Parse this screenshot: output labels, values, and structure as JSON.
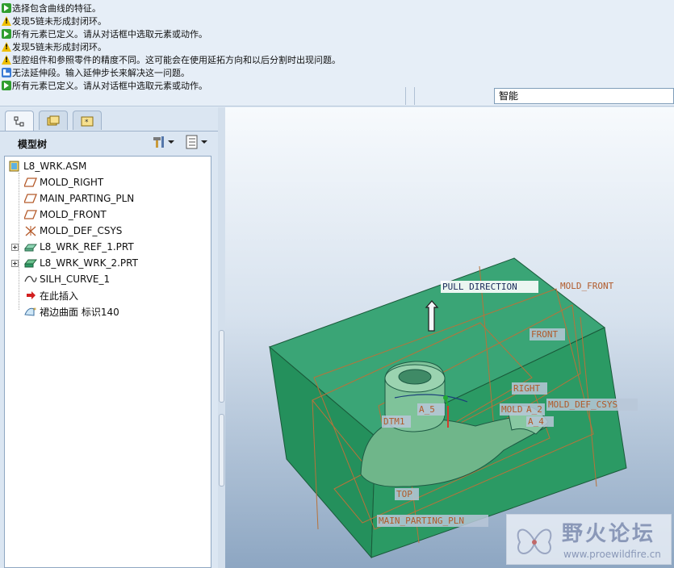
{
  "messages": [
    {
      "type": "ok",
      "text": "选择包含曲线的特征。"
    },
    {
      "type": "warn",
      "text": "发现5链未形成封闭环。"
    },
    {
      "type": "ok",
      "text": "所有元素已定义。请从对话框中选取元素或动作。"
    },
    {
      "type": "warn",
      "text": "发现5链未形成封闭环。"
    },
    {
      "type": "warn",
      "text": "型腔组件和参照零件的精度不同。这可能会在使用延拓方向和以后分割时出现问题。"
    },
    {
      "type": "err",
      "text": "无法延伸段。输入延伸步长来解决这一问题。"
    },
    {
      "type": "ok",
      "text": "所有元素已定义。请从对话框中选取元素或动作。"
    }
  ],
  "filter": {
    "value": "智能"
  },
  "panel": {
    "tabs": [
      "model-tree",
      "folder-browser",
      "favorites"
    ],
    "title": "模型树",
    "tree": [
      {
        "label": "L8_WRK.ASM",
        "icon": "assembly-icon"
      },
      {
        "label": "MOLD_RIGHT",
        "icon": "datum-plane-icon"
      },
      {
        "label": "MAIN_PARTING_PLN",
        "icon": "datum-plane-icon"
      },
      {
        "label": "MOLD_FRONT",
        "icon": "datum-plane-icon"
      },
      {
        "label": "MOLD_DEF_CSYS",
        "icon": "csys-icon"
      },
      {
        "label": "L8_WRK_REF_1.PRT",
        "icon": "part-icon"
      },
      {
        "label": "L8_WRK_WRK_2.PRT",
        "icon": "workpiece-icon"
      },
      {
        "label": "SILH_CURVE_1",
        "icon": "curve-icon"
      },
      {
        "label": "在此插入",
        "icon": "insert-arrow-icon"
      },
      {
        "label": "裙边曲面 标识140",
        "icon": "surface-icon"
      }
    ]
  },
  "viewport": {
    "labels": {
      "pull_direction": "PULL DIRECTION",
      "mold_front": "MOLD_FRONT",
      "front": "FRONT",
      "right": "RIGHT",
      "csys": "MOLD_DEF_CSYS",
      "mold_label": "MOLD",
      "a2": "A_2",
      "a4": "A_4",
      "a5": "A_5",
      "dtm1": "DTM1",
      "top": "TOP",
      "main_parting": "MAIN_PARTING_PLN"
    },
    "colors": {
      "workpiece": "#2e9a66",
      "datum": "#c07a3a",
      "part": "#6fb68a"
    }
  },
  "watermark": {
    "title": "野火论坛",
    "url": "www.proewildfire.cn"
  }
}
